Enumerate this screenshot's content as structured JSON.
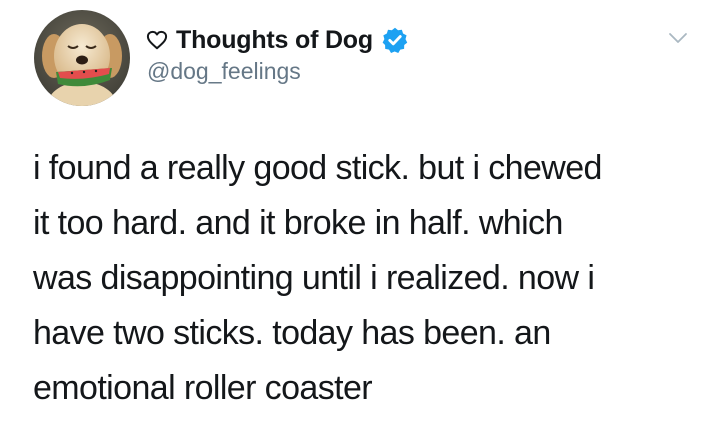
{
  "tweet": {
    "author": {
      "display_name": "Thoughts of Dog",
      "handle": "@dog_feelings",
      "verified": true
    },
    "text_lines": [
      "i found a really good stick. but i chewed",
      "it too hard. and it broke in half. which",
      "was disappointing until i realized. now i",
      "have two sticks. today has been. an",
      "emotional roller coaster"
    ]
  },
  "icons": {
    "name_prefix": "heart-outline-icon",
    "verified": "verified-badge-icon",
    "menu": "chevron-down-icon"
  },
  "colors": {
    "text": "#14171a",
    "secondary_text": "#657786",
    "verified_blue": "#1da1f2"
  }
}
